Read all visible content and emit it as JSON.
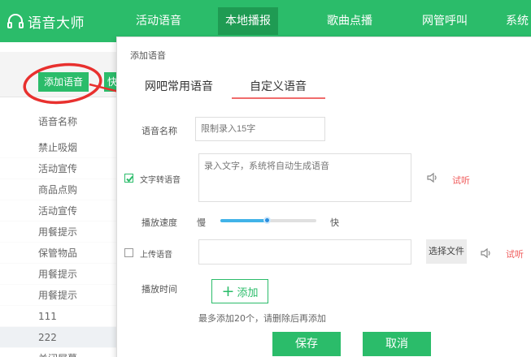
{
  "app": {
    "name": "语音大师"
  },
  "nav": {
    "tabs": [
      {
        "label": "活动语音",
        "active": false
      },
      {
        "label": "本地播报",
        "active": true
      },
      {
        "label": "歌曲点播",
        "active": false
      },
      {
        "label": "网管呼叫",
        "active": false
      },
      {
        "label": "系统",
        "active": false
      }
    ]
  },
  "background": {
    "add_button_label": "添加语音",
    "second_button_label": "快",
    "list_header": "语音名称",
    "items": [
      "禁止吸烟",
      "活动宣传",
      "商品点购",
      "活动宣传",
      "用餐提示",
      "保管物品",
      "用餐提示",
      "用餐提示",
      "111",
      "222",
      "关闭屏幕"
    ],
    "selected_index": 9
  },
  "dialog": {
    "title": "添加语音",
    "tabs": [
      {
        "label": "网吧常用语音",
        "active": false
      },
      {
        "label": "自定义语音",
        "active": true
      }
    ],
    "name_label": "语音名称",
    "name_placeholder": "限制录入15字",
    "tts_label": "文字转语音",
    "tts_checked": true,
    "tts_placeholder": "录入文字，系统将自动生成语音",
    "listen_label": "试听",
    "speed_label": "播放速度",
    "speed_slow": "慢",
    "speed_fast": "快",
    "speed_value": 0.5,
    "upload_label": "上传语音",
    "upload_checked": false,
    "choose_file_label": "选择文件",
    "play_time_label": "播放时间",
    "add_label": "添加",
    "hint": "最多添加20个，请删除后再添加",
    "save_label": "保存",
    "cancel_label": "取消"
  },
  "colors": {
    "brand": "#2bbc6a",
    "brand_dark": "#1f9b53",
    "annotation": "#e8302e",
    "tab_underline": "#f06b6b",
    "slider": "#41b3e8"
  }
}
